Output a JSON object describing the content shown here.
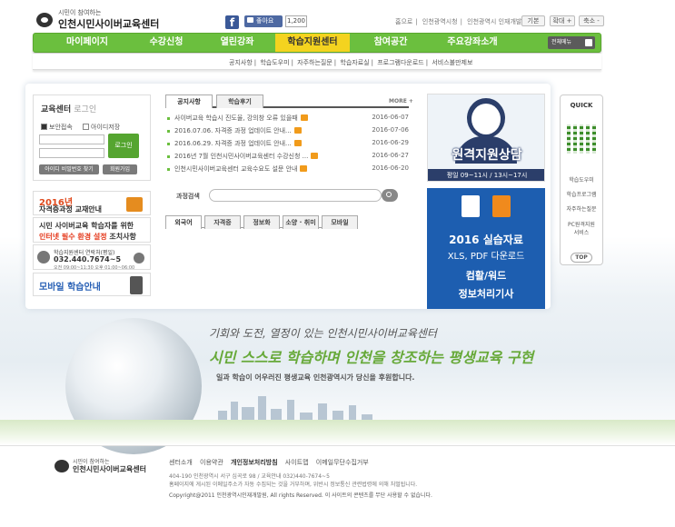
{
  "header": {
    "logo_tag": "시민이 참여하는",
    "logo_name": "인천시민사이버교육센터",
    "fb_like": "좋아요",
    "like_count": "1,200",
    "toplinks": [
      "홈으로",
      "인천광역시청",
      "인천광역시 인재개발원"
    ],
    "size_buttons": [
      "기본",
      "확대 +",
      "축소 -"
    ]
  },
  "nav": {
    "items": [
      "마이페이지",
      "수강신청",
      "열린강좌",
      "학습지원센터",
      "참여공간",
      "주요강좌소개"
    ],
    "active_index": 3,
    "all_menu": "전체메뉴",
    "sub": [
      "공지사항",
      "학습도우미",
      "자주하는질문",
      "학습자료실",
      "프로그램다운로드",
      "서비스불만제보"
    ]
  },
  "login": {
    "title": "교육센터",
    "title_light": "로그인",
    "secure": "보안접속",
    "save_id": "아이디저장",
    "button": "로그인",
    "find": "아이디 비밀번호 찾기",
    "join": "회원가입"
  },
  "left_banners": {
    "b1_year": "2016년",
    "b1_title": "자격증과정 교재안내",
    "b2_line1": "시민 사이버교육 학습자를 위한",
    "b2_red": "인터넷 필수 환경 설정",
    "b2_tail": " 조치사항",
    "b3_label": "학습지원센터 연락처(평일)",
    "b3_phone": "032.440.7674~5",
    "b3_hours": "오전 09:00~11:30  오후 01:00~06:00",
    "b4_title": "모바일 학습안내"
  },
  "news": {
    "tabs": [
      "공지사항",
      "학습후기"
    ],
    "more": "MORE +",
    "items": [
      {
        "title": "사이버교육 학습시 진도율, 강의창 오류 있을때",
        "date": "2016-06-07"
      },
      {
        "title": "2016.07.06. 자격증 과정 업데이트 안내...",
        "date": "2016-07-06"
      },
      {
        "title": "2016.06.29. 자격증 과정 업데이트 안내...",
        "date": "2016-06-29"
      },
      {
        "title": "2016년 7월 인천시민사이버교육센터 수강신청 ...",
        "date": "2016-06-27"
      },
      {
        "title": "인천시민사이버교육센터 교육수요도 설문 안내",
        "date": "2016-06-20"
      }
    ],
    "new_badge": "N"
  },
  "search": {
    "label": "과정검색",
    "placeholder": ""
  },
  "categories": [
    "외국어",
    "자격증",
    "정보화",
    "소양 · 취미",
    "모바일"
  ],
  "right_banners": {
    "r1_title": "원격지원상담",
    "r1_hours": "평일 09~11시 / 13시~17시",
    "r2_line1": "2016 실습자료",
    "r2_line2": "XLS, PDF 다운로드",
    "r2_line3": "컴활/워드",
    "r2_line4": "정보처리기사"
  },
  "quick": {
    "title": "QUICK",
    "items": [
      "학습도우미",
      "학습프로그램",
      "자주하는질문",
      "PC원격지원\n서비스"
    ],
    "top": "TOP"
  },
  "hero": {
    "line1": "기회와 도전, 열정이 있는 인천시민사이버교육센터",
    "line2": "시민 스스로 학습하며 인천을 창조하는 평생교육 구현",
    "line3": "일과 학습이 어우러진 평생교육 인천광역시가 당신을 후원합니다."
  },
  "footer": {
    "logo_tag": "시민이 참여하는",
    "logo_name": "인천시민사이버교육센터",
    "links": [
      "센터소개",
      "이용약관",
      "개인정보처리방침",
      "사이트맵",
      "이메일무단수집거부"
    ],
    "addr1": "404-190 인천광역시 서구 심곡로 98 / 교육안내 032)440-7674~5",
    "addr2": "홈페이지에 게시된 이메일주소가 자동 수집되는 것을 거부하며, 위반시 정보통신 관련법령에 의해 처벌됩니다.",
    "copy": "Copyright@2011 인천광역시인재개발원, All rights Reserved. 이 사이트의 콘텐츠를 무단 사용할 수 없습니다."
  },
  "colors": {
    "nav_green": "#6bbf3e",
    "nav_active": "#f4d31f",
    "new_badge": "#f19b1b",
    "right_blue": "#1d5eb0"
  }
}
